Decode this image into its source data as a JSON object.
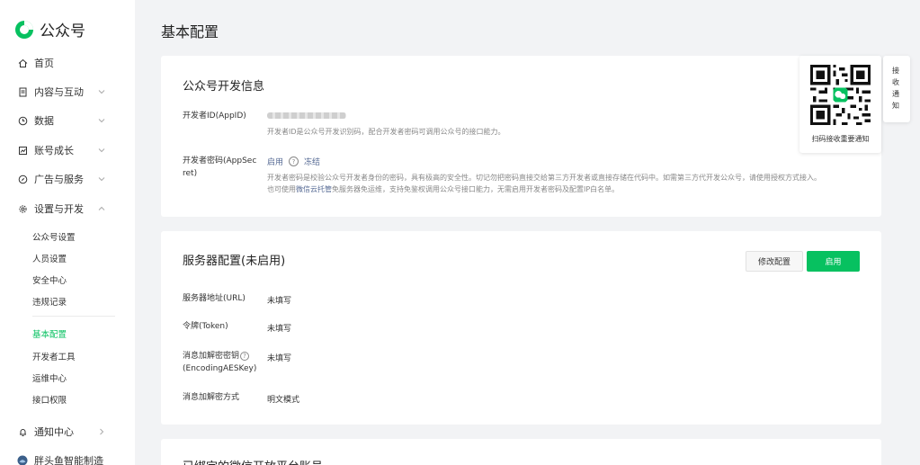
{
  "app": {
    "logo_text": "公众号"
  },
  "sidebar": {
    "items": [
      {
        "label": "首页",
        "icon": "home-icon"
      },
      {
        "label": "内容与互动",
        "icon": "document-icon"
      },
      {
        "label": "数据",
        "icon": "clock-icon"
      },
      {
        "label": "账号成长",
        "icon": "growth-chart-icon"
      },
      {
        "label": "广告与服务",
        "icon": "compass-icon"
      },
      {
        "label": "设置与开发",
        "icon": "gear-icon"
      }
    ],
    "settings_sub": [
      "公众号设置",
      "人员设置",
      "安全中心",
      "违规记录"
    ],
    "dev_sub": [
      "基本配置",
      "开发者工具",
      "运维中心",
      "接口权限"
    ],
    "bottom": [
      {
        "label": "通知中心",
        "icon": "bell-icon"
      },
      {
        "label": "胖头鱼智能制造",
        "icon": "avatar-icon"
      }
    ]
  },
  "page": {
    "title": "基本配置"
  },
  "dev_info": {
    "title": "公众号开发信息",
    "appid_label": "开发者ID(AppID)",
    "appid_desc": "开发者ID是公众号开发识别码，配合开发者密码可调用公众号的接口能力。",
    "secret_label_1": "开发者密码(AppSec",
    "secret_label_2": "ret)",
    "secret_enabled": "启用",
    "secret_help": "?",
    "secret_freeze": "冻结",
    "secret_desc_1": "开发者密码是校验公众号开发者身份的密码，具有极高的安全性。切记勿把密码直接交给第三方开发者或直接存储在代码中。如需第三方代开发公众号，请使用授权方式接入。",
    "secret_desc_2_a": "也可使用",
    "secret_desc_2_link": "微信云托管",
    "secret_desc_2_b": "免服务器免运维，支持免鉴权调用公众号接口能力，无需启用开发者密码及配置IP白名单。"
  },
  "server": {
    "title": "服务器配置(未启用)",
    "modify_button": "修改配置",
    "enable_button": "启用",
    "rows": [
      {
        "label": "服务器地址(URL)",
        "value": "未填写"
      },
      {
        "label": "令牌(Token)",
        "value": "未填写"
      },
      {
        "label": "消息加解密密钥",
        "label2": "(EncodingAESKey)",
        "value": "未填写"
      },
      {
        "label": "消息加解密方式",
        "value": "明文模式"
      }
    ],
    "help": "?"
  },
  "bound": {
    "title": "已绑定的微信开放平台账号"
  },
  "qr": {
    "caption": "扫码接收重要通知",
    "side_text": "接收通知"
  },
  "colors": {
    "accent": "#07c160",
    "link": "#576b95"
  }
}
